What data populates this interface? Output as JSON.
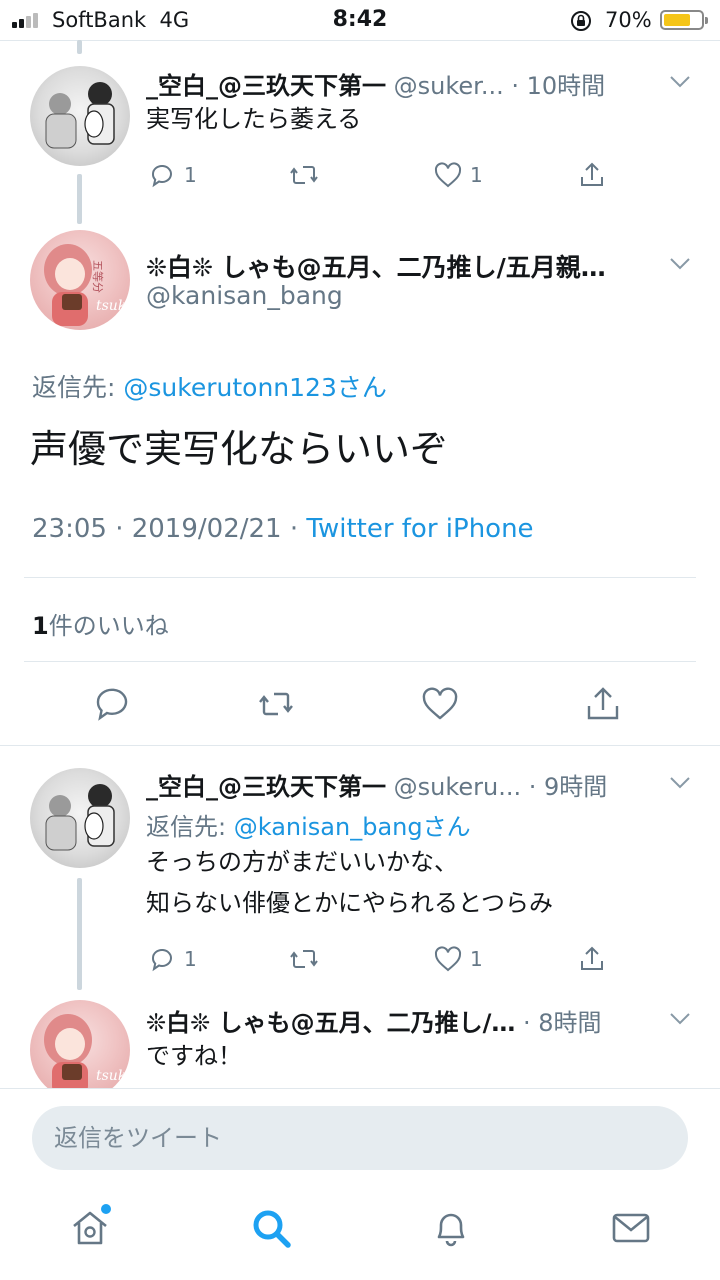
{
  "status_bar": {
    "carrier": "SoftBank",
    "network": "4G",
    "time": "8:42",
    "battery": "70%",
    "battery_level": 0.7
  },
  "tweets": [
    {
      "name": "_空白_@三玖天下第一",
      "handle": "@suker...",
      "time": "· 10時間",
      "text": "実写化したら萎える",
      "reply_count": "1",
      "like_count": "1"
    },
    {
      "name": "_空白_@三玖天下第一",
      "handle": "@sukeru...",
      "time": "· 9時間",
      "reply_to_prefix": "返信先:",
      "reply_to_mention": "@kanisan_bangさん",
      "text_lines": [
        "そっちの方がまだいいかな、",
        "知らない俳優とかにやられるとつらみ"
      ],
      "reply_count": "1",
      "like_count": "1"
    },
    {
      "name": "❊白❊ しゃも@五月、二乃推し/…",
      "time": "· 8時間",
      "text": "ですね！"
    }
  ],
  "main_tweet": {
    "name": "❊白❊ しゃも@五月、二乃推し/五月親…",
    "handle": "@kanisan_bang",
    "reply_to_prefix": "返信先:",
    "reply_to_mention": "@sukerutonn123さん",
    "text": "声優で実写化ならいいぞ",
    "timestamp": "23:05 · 2019/02/21 · ",
    "source": "Twitter for iPhone",
    "like_count": "1",
    "like_label": "件のいいね"
  },
  "reply_bar": {
    "placeholder": "返信をツイート"
  },
  "tab_bar": {
    "items": [
      "home-icon",
      "search-icon",
      "bell-icon",
      "mail-icon"
    ]
  },
  "colors": {
    "accent": "#1da1f2",
    "link": "#1b95e0",
    "muted": "#657786",
    "battery": "#f5c518"
  }
}
